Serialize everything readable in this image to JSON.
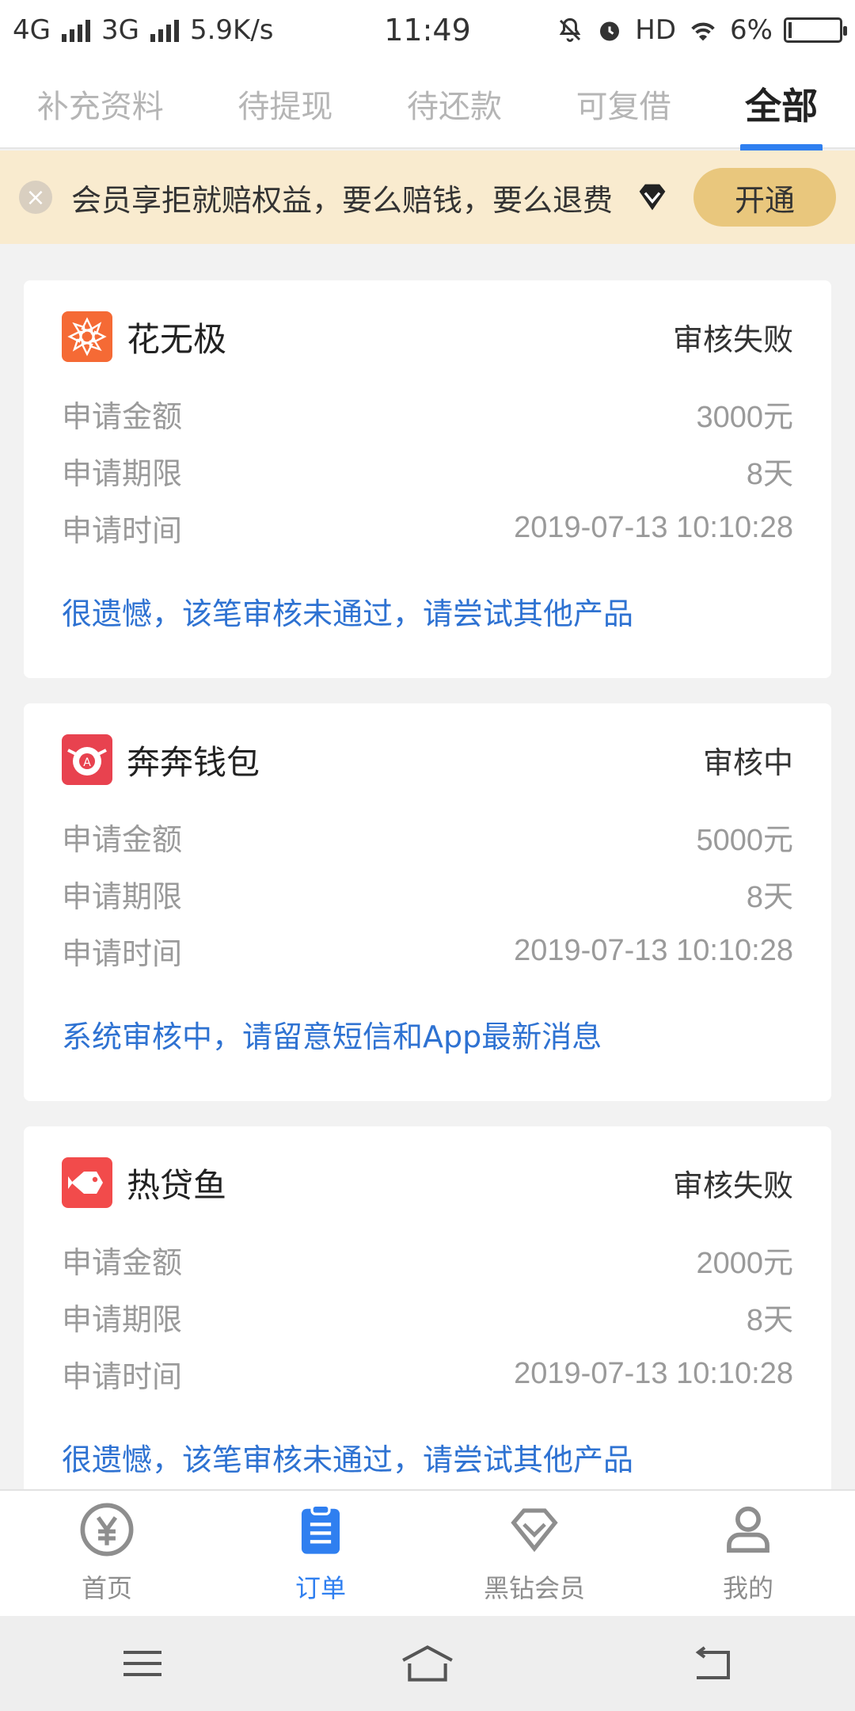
{
  "status_bar": {
    "network1": "4G",
    "network2": "3G",
    "speed": "5.9K/s",
    "time": "11:49",
    "hd": "HD",
    "battery_percent": "6%",
    "battery_level": 0.06,
    "icons": [
      "mute-icon",
      "alarm-icon",
      "wifi-icon",
      "battery-icon"
    ]
  },
  "tabs": [
    {
      "label": "补充资料",
      "active": false
    },
    {
      "label": "待提现",
      "active": false
    },
    {
      "label": "待还款",
      "active": false
    },
    {
      "label": "可复借",
      "active": false
    },
    {
      "label": "全部",
      "active": true
    }
  ],
  "banner": {
    "text": "会员享拒就赔权益，要么赔钱，要么退费",
    "button": "开通",
    "close_icon": "close-icon",
    "badge_icon": "black-diamond-icon"
  },
  "labels": {
    "amount": "申请金额",
    "period": "申请期限",
    "time": "申请时间"
  },
  "orders": [
    {
      "product": "花无极",
      "logo_icon": "flower-logo-icon",
      "logo_color": "#f56a35",
      "status": "审核失败",
      "amount": "3000元",
      "period": "8天",
      "time": "2019-07-13 10:10:28",
      "message": "很遗憾，该笔审核未通过，请尝试其他产品"
    },
    {
      "product": "奔奔钱包",
      "logo_icon": "wallet-logo-icon",
      "logo_color": "#e8424f",
      "status": "审核中",
      "amount": "5000元",
      "period": "8天",
      "time": "2019-07-13 10:10:28",
      "message": "系统审核中，请留意短信和App最新消息"
    },
    {
      "product": "热贷鱼",
      "logo_icon": "fish-logo-icon",
      "logo_color": "#f24b4b",
      "status": "审核失败",
      "amount": "2000元",
      "period": "8天",
      "time": "2019-07-13 10:10:28",
      "message": "很遗憾，该笔审核未通过，请尝试其他产品"
    }
  ],
  "bottom_nav": [
    {
      "label": "首页",
      "icon": "yuan-icon",
      "active": false
    },
    {
      "label": "订单",
      "icon": "clipboard-icon",
      "active": true
    },
    {
      "label": "黑钻会员",
      "icon": "diamond-icon",
      "active": false
    },
    {
      "label": "我的",
      "icon": "user-icon",
      "active": false
    }
  ],
  "colors": {
    "accent": "#2f7ff0",
    "message": "#2e72d2",
    "banner_bg": "#f9ebcf",
    "banner_button": "#e9c77d"
  }
}
